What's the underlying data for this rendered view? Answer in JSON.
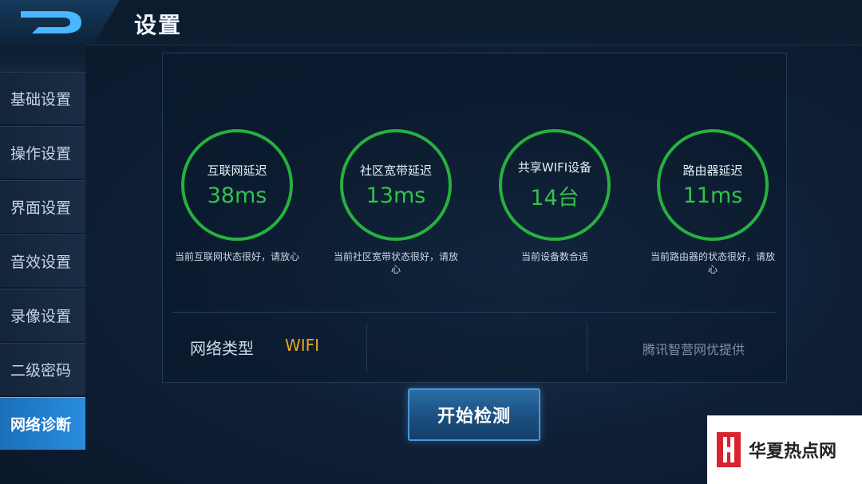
{
  "header": {
    "title": "设置",
    "back_icon": "back-arrow-icon"
  },
  "sidebar": {
    "items": [
      {
        "label": "基础设置",
        "active": false
      },
      {
        "label": "操作设置",
        "active": false
      },
      {
        "label": "界面设置",
        "active": false
      },
      {
        "label": "音效设置",
        "active": false
      },
      {
        "label": "录像设置",
        "active": false
      },
      {
        "label": "二级密码",
        "active": false
      },
      {
        "label": "网络诊断",
        "active": true
      }
    ]
  },
  "metrics": [
    {
      "label": "互联网延迟",
      "value": "38ms",
      "note": "当前互联网状态很好，请放心"
    },
    {
      "label": "社区宽带延迟",
      "value": "13ms",
      "note": "当前社区宽带状态很好，请放心"
    },
    {
      "label": "共享WIFI设备",
      "value": "14台",
      "note": "当前设备数合适"
    },
    {
      "label": "路由器延迟",
      "value": "11ms",
      "note": "当前路由器的状态很好，请放心"
    }
  ],
  "network": {
    "type_label": "网络类型",
    "type_value": "WIFI",
    "provider": "腾讯智营网优提供"
  },
  "start_button": "开始检测",
  "watermark": {
    "text": "华夏热点网"
  },
  "colors": {
    "ring": "#27b03f",
    "value": "#33c24a",
    "wifi": "#e8a623",
    "active_tab": "#2a8de0"
  }
}
